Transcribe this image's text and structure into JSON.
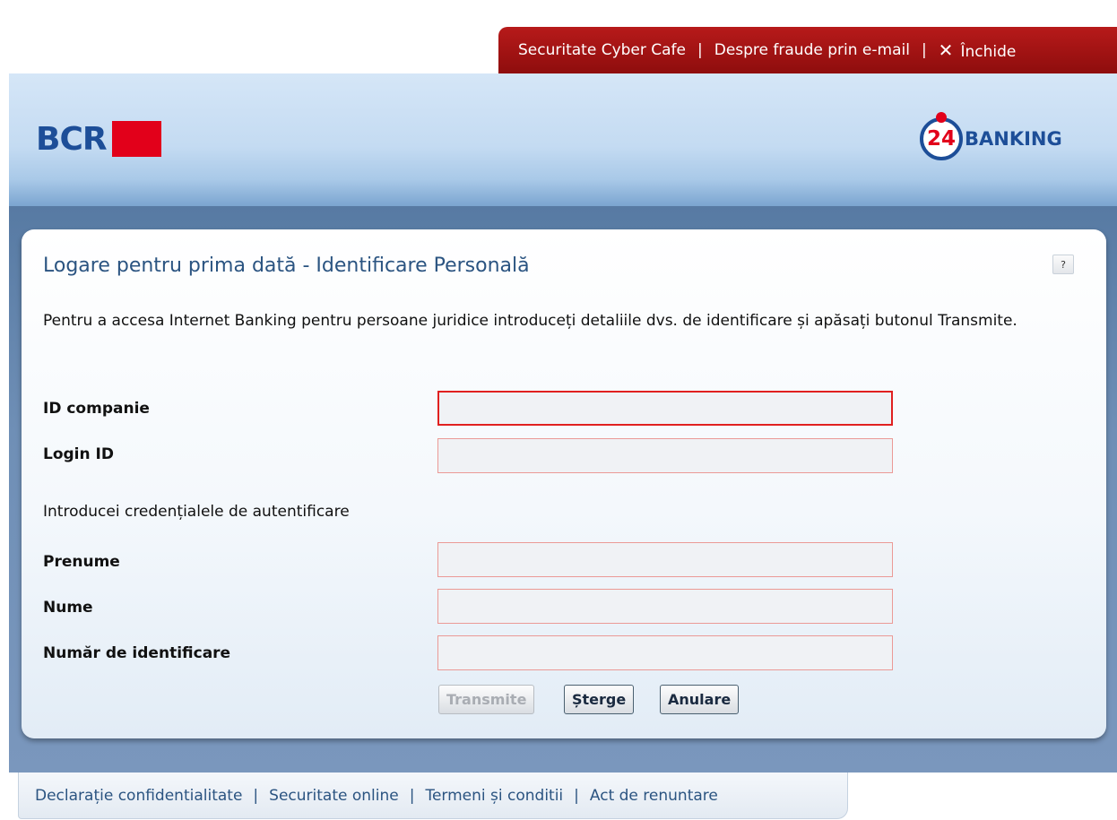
{
  "top_links": {
    "cyber_cafe": "Securitate Cyber Cafe",
    "fraud": "Despre fraude prin e-mail",
    "close_symbol": "✕",
    "close": "Închide",
    "separator": "|"
  },
  "header": {
    "bank_logo_text": "BCR",
    "banking_logo_number": "24",
    "banking_logo_word": "BANKING"
  },
  "form": {
    "title": "Logare pentru prima dată - Identificare Personală",
    "help_label": "?",
    "intro": "Pentru a accesa Internet Banking pentru persoane juridice introduceți detaliile dvs. de identificare și apăsați butonul Transmite.",
    "company_id_label": "ID companie",
    "company_id_value": "",
    "login_id_label": "Login ID",
    "login_id_value": "",
    "credentials_note": "Introducei credențialele de autentificare",
    "first_name_label": "Prenume",
    "first_name_value": "",
    "last_name_label": "Nume",
    "last_name_value": "",
    "id_number_label": "Număr de identificare",
    "id_number_value": "",
    "submit_label": "Transmite",
    "clear_label": "Șterge",
    "cancel_label": "Anulare"
  },
  "footer": {
    "privacy": "Declarație confidentialitate",
    "security": "Securitate online",
    "terms": "Termeni și conditii",
    "waiver": "Act de renuntare",
    "separator": "|"
  },
  "colors": {
    "brand_blue": "#1d4e98",
    "brand_red": "#e2001a",
    "top_bar_red": "#a01212",
    "title_blue": "#2b5481"
  }
}
